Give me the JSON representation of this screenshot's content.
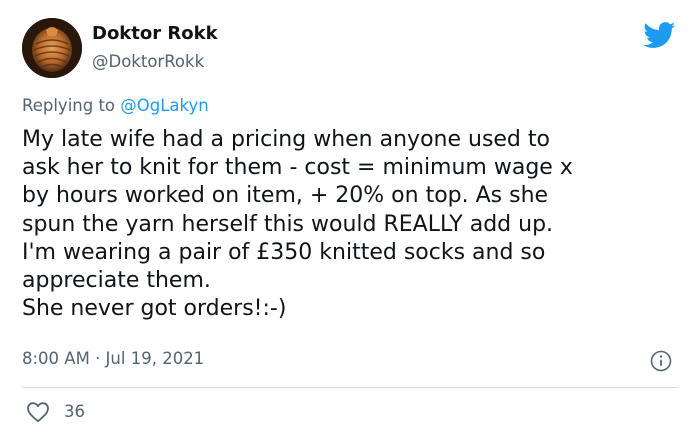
{
  "author": {
    "name": "Doktor Rokk",
    "handle": "@DoktorRokk",
    "avatar_icon": "avatar-wooden-sculpture"
  },
  "brand": {
    "icon": "twitter-bird-icon",
    "color": "#1d9bf0"
  },
  "reply": {
    "prefix": "Replying to ",
    "mention": "@OgLakyn"
  },
  "tweet": {
    "lines": [
      "My late wife had a pricing when anyone used to",
      "ask her to knit for them - cost = minimum wage x",
      "by hours worked on item, + 20% on top. As she",
      "spun the yarn herself this would REALLY add up.",
      "I'm wearing a pair of £350 knitted socks and so",
      "appreciate them.",
      "She never got orders!:-)"
    ]
  },
  "meta": {
    "timestamp": "8:00 AM · Jul 19, 2021",
    "info_icon": "info-icon"
  },
  "stats": {
    "likes": "36",
    "like_icon": "heart-icon"
  }
}
